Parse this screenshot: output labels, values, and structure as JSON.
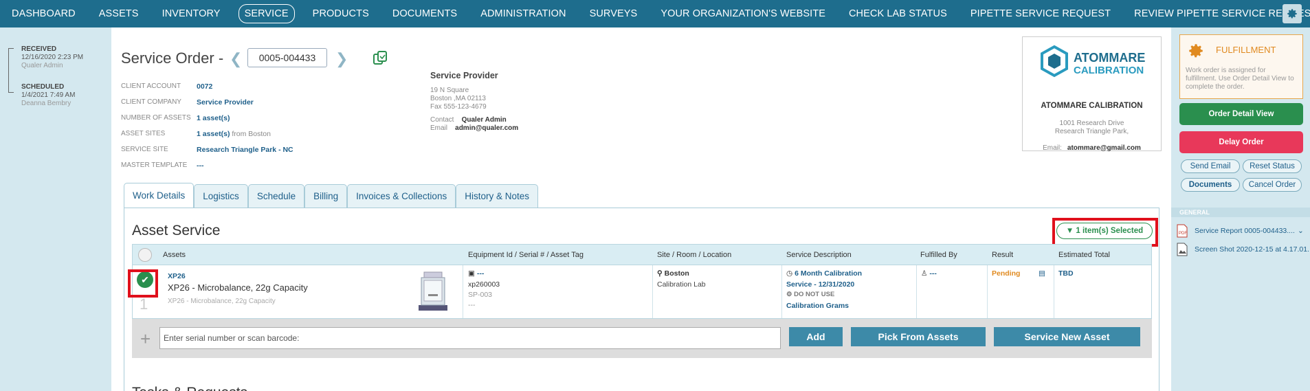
{
  "nav": {
    "left": [
      "DASHBOARD",
      "ASSETS",
      "INVENTORY",
      "SERVICE",
      "PRODUCTS",
      "DOCUMENTS",
      "ADMINISTRATION"
    ],
    "active": "SERVICE",
    "right": [
      "SURVEYS",
      "YOUR ORGANIZATION'S WEBSITE",
      "CHECK LAB STATUS",
      "PIPETTE SERVICE REQUEST",
      "REVIEW PIPETTE SERVICE REQUEST"
    ]
  },
  "timeline": {
    "received": {
      "label": "RECEIVED",
      "date": "12/16/2020 2:23 PM",
      "user": "Qualer Admin"
    },
    "scheduled": {
      "label": "SCHEDULED",
      "date": "1/4/2021 7:49 AM",
      "user": "Deanna Bembry"
    }
  },
  "order": {
    "title": "Service Order -",
    "number": "0005-004433"
  },
  "info": {
    "client_account": {
      "label": "CLIENT ACCOUNT",
      "value": "0072"
    },
    "client_company": {
      "label": "CLIENT COMPANY",
      "value": "Service Provider"
    },
    "number_of_assets": {
      "label": "NUMBER OF ASSETS",
      "value": "1 asset(s)"
    },
    "asset_sites": {
      "label": "ASSET SITES",
      "value": "1 asset(s)",
      "suffix": "from Boston"
    },
    "service_site": {
      "label": "SERVICE SITE",
      "value": "Research Triangle Park - NC"
    },
    "master_template": {
      "label": "MASTER TEMPLATE",
      "value": "---"
    }
  },
  "provider": {
    "title": "Service Provider",
    "address1": "19 N Square",
    "address2": "Boston ,MA 02113",
    "fax": "Fax 555-123-4679",
    "contact_label": "Contact",
    "contact": "Qualer Admin",
    "email_label": "Email",
    "email": "admin@qualer.com"
  },
  "vendor": {
    "logo_line1": "ATOMMARE",
    "logo_line2": "CALIBRATION",
    "name": "ATOMMARE CALIBRATION",
    "address1": "1001 Research Drive",
    "address2": "Research Triangle Park,",
    "email_label": "Email:",
    "email": "atommare@gmail.com"
  },
  "tabs": [
    "Work Details",
    "Logistics",
    "Schedule",
    "Billing",
    "Invoices & Collections",
    "History & Notes"
  ],
  "asset_service": {
    "heading": "Asset Service",
    "selected_label": "1 item(s) Selected",
    "columns": [
      "Assets",
      "Equipment Id / Serial # / Asset Tag",
      "Site / Room / Location",
      "Service Description",
      "Fulfilled By",
      "Result",
      "Estimated Total"
    ],
    "row": {
      "code": "XP26",
      "name": "XP26 - Microbalance, 22g Capacity",
      "sub": "XP26 - Microbalance, 22g Capacity",
      "index": "1",
      "equipment_id": "---",
      "serial": "xp260003",
      "asset_tag": "SP-003",
      "extra": "---",
      "site": "Boston",
      "room": "Calibration Lab",
      "service": "6 Month Calibration",
      "service_due": "Service - 12/31/2020",
      "do_not_use": "DO NOT USE",
      "service_note": "Calibration Grams",
      "fulfilled_by": "---",
      "result": "Pending",
      "total": "TBD"
    },
    "serial_placeholder": "Enter serial number or scan barcode:",
    "add_label": "Add",
    "pick_label": "Pick From Assets",
    "new_label": "Service New Asset"
  },
  "tasks_heading": "Tasks & Requests",
  "sidebar": {
    "fulfillment_title": "FULFILLMENT",
    "fulfillment_desc": "Work order is assigned for fulfillment. Use Order Detail View to complete the order.",
    "order_detail": "Order Detail View",
    "delay": "Delay Order",
    "send_email": "Send Email",
    "reset_status": "Reset Status",
    "documents": "Documents",
    "cancel_order": "Cancel Order",
    "general": "GENERAL",
    "files": [
      "Service Report 0005-004433....",
      "Screen Shot 2020-12-15 at 4.17.01..."
    ]
  },
  "colors": {
    "nav": "#1e6d8d",
    "green": "#2a8f4e",
    "red": "#e8385a",
    "highlight": "#e0101c"
  }
}
